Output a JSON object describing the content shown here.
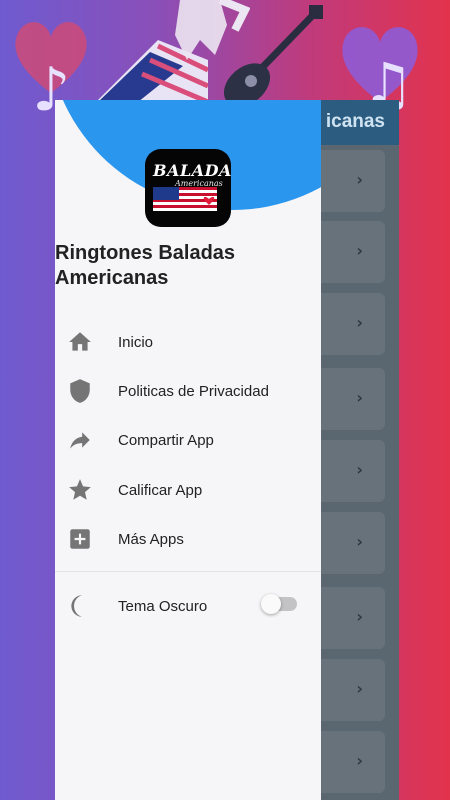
{
  "app_bar": {
    "title": "icanas"
  },
  "drawer": {
    "logo": {
      "text": "BALADAS",
      "subtext": "Americanas"
    },
    "app_name": "Ringtones Baladas Americanas",
    "items": [
      {
        "label": "Inicio",
        "icon": "home-icon"
      },
      {
        "label": "Politicas de Privacidad",
        "icon": "shield-icon"
      },
      {
        "label": "Compartir App",
        "icon": "share-icon"
      },
      {
        "label": "Calificar App",
        "icon": "star-icon"
      },
      {
        "label": "Más Apps",
        "icon": "add-box-icon"
      }
    ],
    "dark_theme": {
      "label": "Tema Oscuro",
      "icon": "moon-icon",
      "enabled": false
    }
  },
  "list": {
    "chevron": "›"
  },
  "colors": {
    "accent": "#2b96ee",
    "drawer_bg": "#f6f6f8",
    "icon": "#757575",
    "appbar": "#2c5d80"
  }
}
